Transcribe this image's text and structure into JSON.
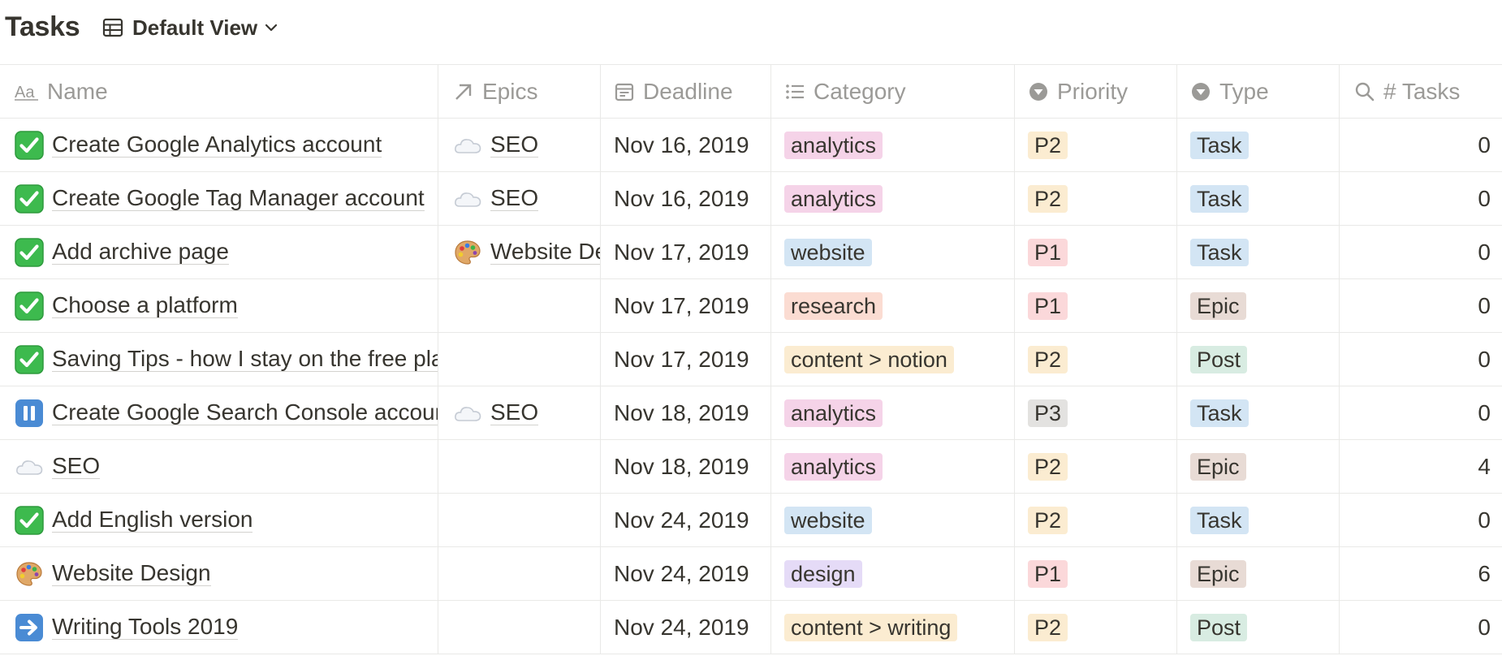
{
  "page": {
    "title": "Tasks",
    "view_label": "Default View"
  },
  "columns": {
    "name": "Name",
    "epics": "Epics",
    "deadline": "Deadline",
    "category": "Category",
    "priority": "Priority",
    "type": "Type",
    "tasks": "# Tasks"
  },
  "tag_colors": {
    "analytics": "#f5d3e8",
    "website": "#d3e5f4",
    "research": "#fbdcd2",
    "content": "#fbecd1",
    "design": "#e5dbf7",
    "P1": "#fbd8da",
    "P2": "#fbecd1",
    "P3": "#e3e2e0",
    "Task": "#d3e5f4",
    "Epic": "#e8dbd5",
    "Post": "#d8ece2"
  },
  "rows": [
    {
      "icon": "check-icon",
      "name": "Create Google Analytics account",
      "epic_icon": "cloud-icon",
      "epic": "SEO",
      "deadline": "Nov 16, 2019",
      "category": "analytics",
      "category_color": "#f5d3e8",
      "priority": "P2",
      "priority_color": "#fbecd1",
      "type": "Task",
      "type_color": "#d3e5f4",
      "tasks": "0"
    },
    {
      "icon": "check-icon",
      "name": "Create Google Tag Manager account",
      "epic_icon": "cloud-icon",
      "epic": "SEO",
      "deadline": "Nov 16, 2019",
      "category": "analytics",
      "category_color": "#f5d3e8",
      "priority": "P2",
      "priority_color": "#fbecd1",
      "type": "Task",
      "type_color": "#d3e5f4",
      "tasks": "0"
    },
    {
      "icon": "check-icon",
      "name": "Add archive page",
      "epic_icon": "palette-icon",
      "epic": "Website Design",
      "deadline": "Nov 17, 2019",
      "category": "website",
      "category_color": "#d3e5f4",
      "priority": "P1",
      "priority_color": "#fbd8da",
      "type": "Task",
      "type_color": "#d3e5f4",
      "tasks": "0"
    },
    {
      "icon": "check-icon",
      "name": "Choose a platform",
      "epic_icon": "",
      "epic": "",
      "deadline": "Nov 17, 2019",
      "category": "research",
      "category_color": "#fbdcd2",
      "priority": "P1",
      "priority_color": "#fbd8da",
      "type": "Epic",
      "type_color": "#e8dbd5",
      "tasks": "0"
    },
    {
      "icon": "check-icon",
      "name": "Saving Tips - how I stay on the free plan",
      "epic_icon": "",
      "epic": "",
      "deadline": "Nov 17, 2019",
      "category": "content > notion",
      "category_color": "#fbecd1",
      "priority": "P2",
      "priority_color": "#fbecd1",
      "type": "Post",
      "type_color": "#d8ece2",
      "tasks": "0"
    },
    {
      "icon": "pause-icon",
      "name": "Create Google Search Console account",
      "epic_icon": "cloud-icon",
      "epic": "SEO",
      "deadline": "Nov 18, 2019",
      "category": "analytics",
      "category_color": "#f5d3e8",
      "priority": "P3",
      "priority_color": "#e3e2e0",
      "type": "Task",
      "type_color": "#d3e5f4",
      "tasks": "0"
    },
    {
      "icon": "cloud-icon",
      "name": "SEO",
      "epic_icon": "",
      "epic": "",
      "deadline": "Nov 18, 2019",
      "category": "analytics",
      "category_color": "#f5d3e8",
      "priority": "P2",
      "priority_color": "#fbecd1",
      "type": "Epic",
      "type_color": "#e8dbd5",
      "tasks": "4"
    },
    {
      "icon": "check-icon",
      "name": "Add English version",
      "epic_icon": "",
      "epic": "",
      "deadline": "Nov 24, 2019",
      "category": "website",
      "category_color": "#d3e5f4",
      "priority": "P2",
      "priority_color": "#fbecd1",
      "type": "Task",
      "type_color": "#d3e5f4",
      "tasks": "0"
    },
    {
      "icon": "palette-icon",
      "name": "Website Design",
      "epic_icon": "",
      "epic": "",
      "deadline": "Nov 24, 2019",
      "category": "design",
      "category_color": "#e5dbf7",
      "priority": "P1",
      "priority_color": "#fbd8da",
      "type": "Epic",
      "type_color": "#e8dbd5",
      "tasks": "6"
    },
    {
      "icon": "arrow-right-icon",
      "name": "Writing Tools 2019",
      "epic_icon": "",
      "epic": "",
      "deadline": "Nov 24, 2019",
      "category": "content > writing",
      "category_color": "#fbecd1",
      "priority": "P2",
      "priority_color": "#fbecd1",
      "type": "Post",
      "type_color": "#d8ece2",
      "tasks": "0"
    }
  ]
}
